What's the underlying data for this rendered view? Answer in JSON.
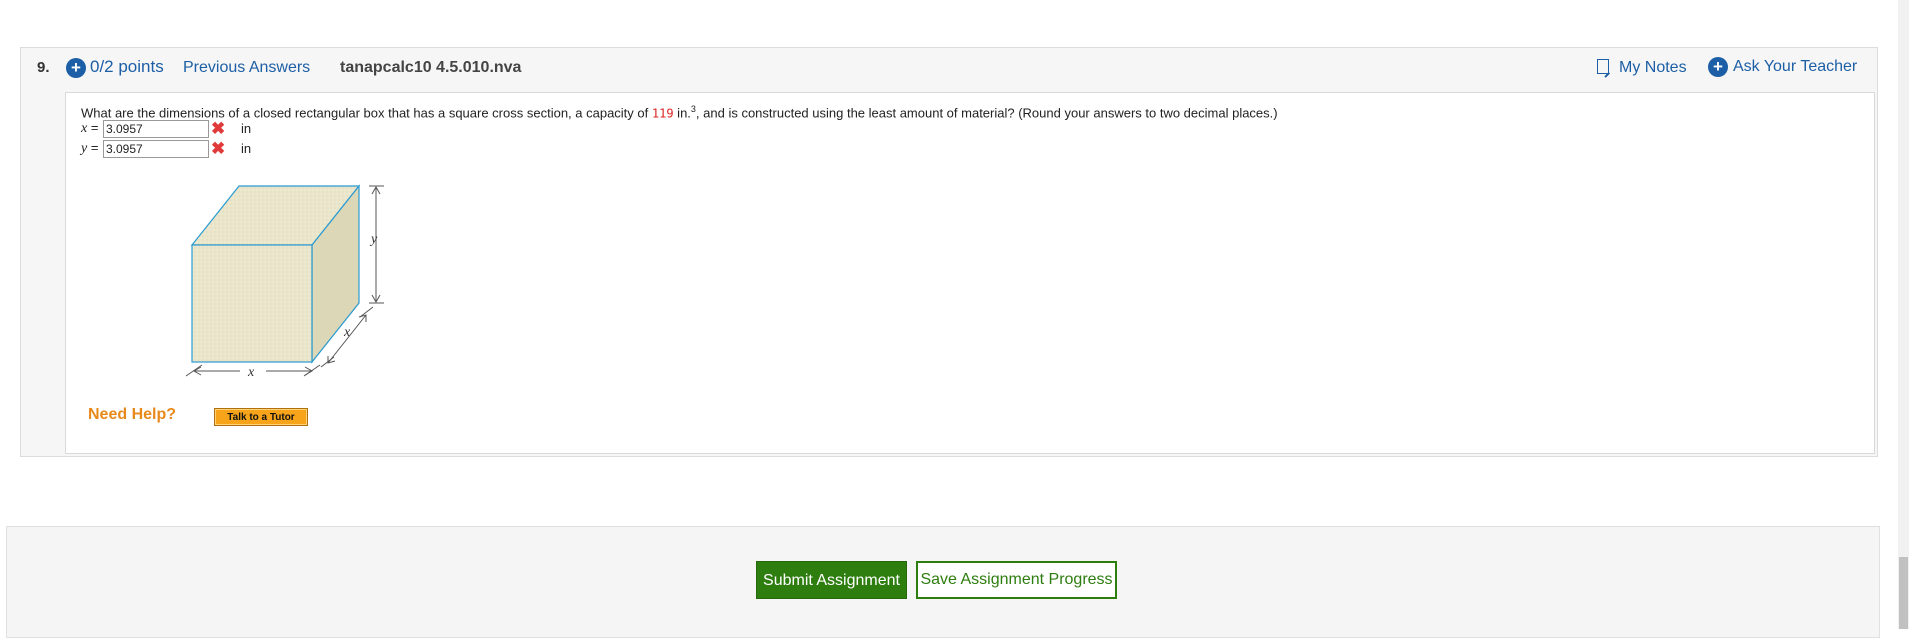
{
  "question": {
    "number": "9.",
    "points": "0/2 points",
    "previous_answers": "Previous Answers",
    "id": "tanapcalc10 4.5.010.nva",
    "my_notes": "My Notes",
    "ask_teacher": "Ask Your Teacher",
    "text_before": "What are the dimensions of a closed rectangular box that has a square cross section, a capacity of ",
    "capacity": "119",
    "unit_base": " in.",
    "unit_exp": "3",
    "text_after": ", and is constructed using the least amount of material? (Round your answers to two decimal places.)"
  },
  "answers": [
    {
      "var": "x",
      "eq": " =",
      "value": "3.0957",
      "unit": "in",
      "status": "incorrect"
    },
    {
      "var": "y",
      "eq": " =",
      "value": "3.0957",
      "unit": "in",
      "status": "incorrect"
    }
  ],
  "figure": {
    "label_x_front": "x",
    "label_x_side": "x",
    "label_y": "y",
    "fill_color": "#e9e5c8",
    "edge_color": "#2a9ad1"
  },
  "help": {
    "need_help": "Need Help?",
    "tutor_button": "Talk to a Tutor"
  },
  "footer": {
    "submit": "Submit Assignment",
    "save": "Save Assignment Progress"
  },
  "colors": {
    "link": "#1d5fa6",
    "error": "#e03a3a",
    "submit_bg": "#2e7d0f",
    "help_orange": "#e8891c"
  }
}
